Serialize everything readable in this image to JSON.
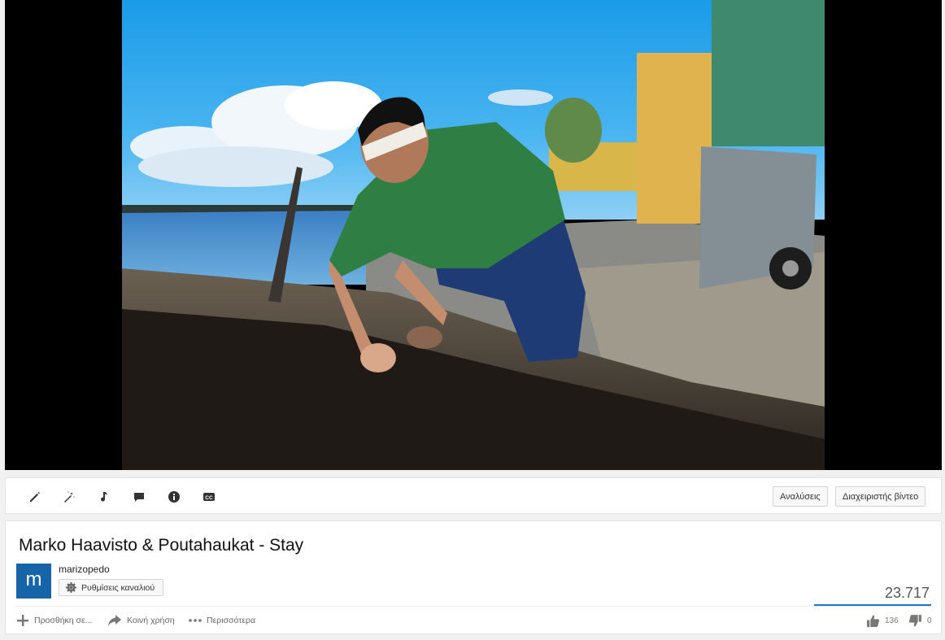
{
  "player": {
    "frame_description_icon": "video-frame"
  },
  "toolbar": {
    "icons": [
      "pencil-icon",
      "magic-wand-icon",
      "music-note-icon",
      "comment-icon",
      "info-icon",
      "cc-icon"
    ],
    "analytics_label": "Αναλύσεις",
    "video_manager_label": "Διαχειριστής βίντεο"
  },
  "video": {
    "title": "Marko Haavisto & Poutahaukat - Stay",
    "channel_name": "marizopedo",
    "avatar_letter": "m",
    "channel_settings_label": "Ρυθμίσεις καναλιού",
    "views": "23.717",
    "likes": "136",
    "dislikes": "0"
  },
  "actions": {
    "add_to_label": "Προσθήκη σε...",
    "share_label": "Κοινή χρήση",
    "more_label": "Περισσότερα"
  },
  "colors": {
    "avatar_bg": "#1565a8",
    "views_bar": "#1e76c9",
    "player_bg": "#000000"
  }
}
